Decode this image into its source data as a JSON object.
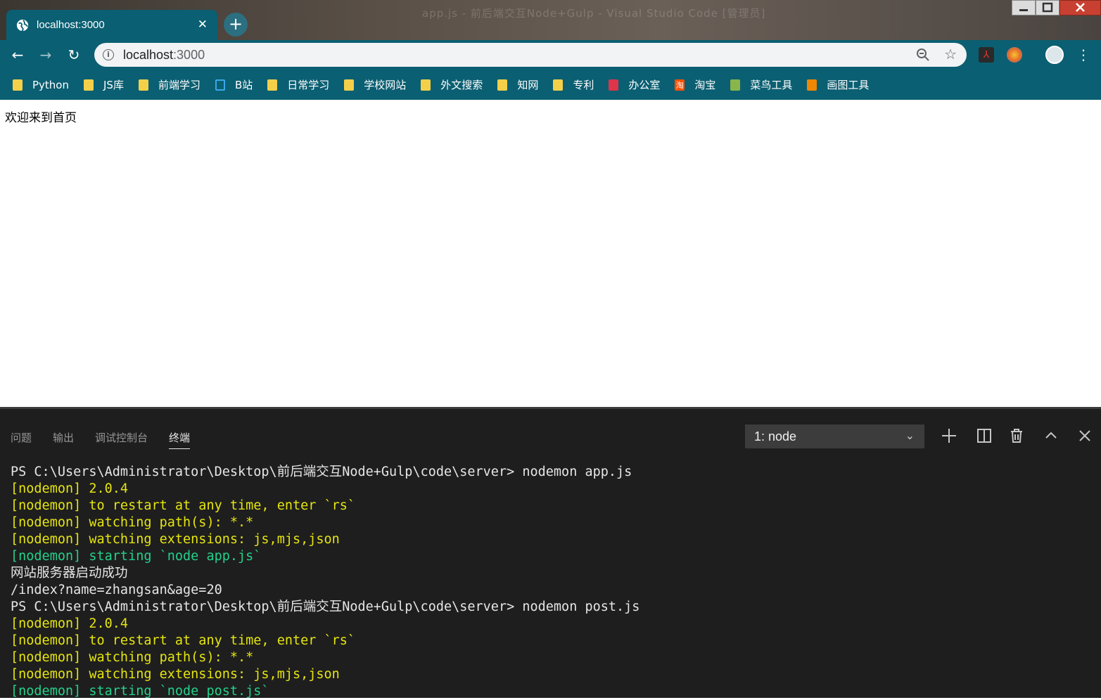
{
  "window": {
    "title_blurred": "app.js - 前后端交互Node+Gulp - Visual Studio Code [管理员]"
  },
  "tab": {
    "title": "localhost:3000",
    "close_glyph": "✕",
    "new_tab_glyph": "+"
  },
  "toolbar": {
    "back_glyph": "←",
    "forward_glyph": "→",
    "reload_glyph": "↻",
    "url_host": "localhost",
    "url_port": ":3000",
    "star_glyph": "☆",
    "menu_glyph": "⋮"
  },
  "bookmarks": [
    {
      "label": "Python",
      "icon": "folder-icon"
    },
    {
      "label": "JS库",
      "icon": "folder-icon"
    },
    {
      "label": "前端学习",
      "icon": "folder-icon"
    },
    {
      "label": "B站",
      "icon": "bilibili-icon"
    },
    {
      "label": "日常学习",
      "icon": "folder-icon"
    },
    {
      "label": "学校网站",
      "icon": "folder-icon"
    },
    {
      "label": "外文搜索",
      "icon": "folder-icon"
    },
    {
      "label": "知网",
      "icon": "folder-icon"
    },
    {
      "label": "专利",
      "icon": "folder-icon"
    },
    {
      "label": "办公室",
      "icon": "office-icon"
    },
    {
      "label": "淘宝",
      "icon": "taobao-icon"
    },
    {
      "label": "菜鸟工具",
      "icon": "runoob-icon"
    },
    {
      "label": "画图工具",
      "icon": "drawio-icon"
    }
  ],
  "page": {
    "body_text": "欢迎来到首页"
  },
  "panel": {
    "tabs": [
      "问题",
      "输出",
      "调试控制台",
      "终端"
    ],
    "active_tab": "终端",
    "terminal_select": "1: node",
    "icons": [
      "plus-icon",
      "split-icon",
      "trash-icon",
      "chevron-up-icon",
      "close-icon"
    ]
  },
  "terminal": {
    "lines": [
      {
        "text": "PS C:\\Users\\Administrator\\Desktop\\前后端交互Node+Gulp\\code\\server> nodemon app.js",
        "color": "white"
      },
      {
        "text": "[nodemon] 2.0.4",
        "color": "yellow"
      },
      {
        "text": "[nodemon] to restart at any time, enter `rs`",
        "color": "yellow"
      },
      {
        "text": "[nodemon] watching path(s): *.*",
        "color": "yellow"
      },
      {
        "text": "[nodemon] watching extensions: js,mjs,json",
        "color": "yellow"
      },
      {
        "text": "[nodemon] starting `node app.js`",
        "color": "green"
      },
      {
        "text": "网站服务器启动成功",
        "color": "white"
      },
      {
        "text": "/index?name=zhangsan&age=20",
        "color": "white"
      },
      {
        "text": "PS C:\\Users\\Administrator\\Desktop\\前后端交互Node+Gulp\\code\\server> nodemon post.js",
        "color": "white"
      },
      {
        "text": "[nodemon] 2.0.4",
        "color": "yellow"
      },
      {
        "text": "[nodemon] to restart at any time, enter `rs`",
        "color": "yellow"
      },
      {
        "text": "[nodemon] watching path(s): *.*",
        "color": "yellow"
      },
      {
        "text": "[nodemon] watching extensions: js,mjs,json",
        "color": "yellow"
      },
      {
        "text": "[nodemon] starting `node post.js`",
        "color": "green"
      }
    ]
  },
  "colors": {
    "chrome_theme": "#0b5f72",
    "terminal_bg": "#1e1e1e",
    "terminal_yellow": "#e5e510",
    "terminal_green": "#23d18b"
  }
}
